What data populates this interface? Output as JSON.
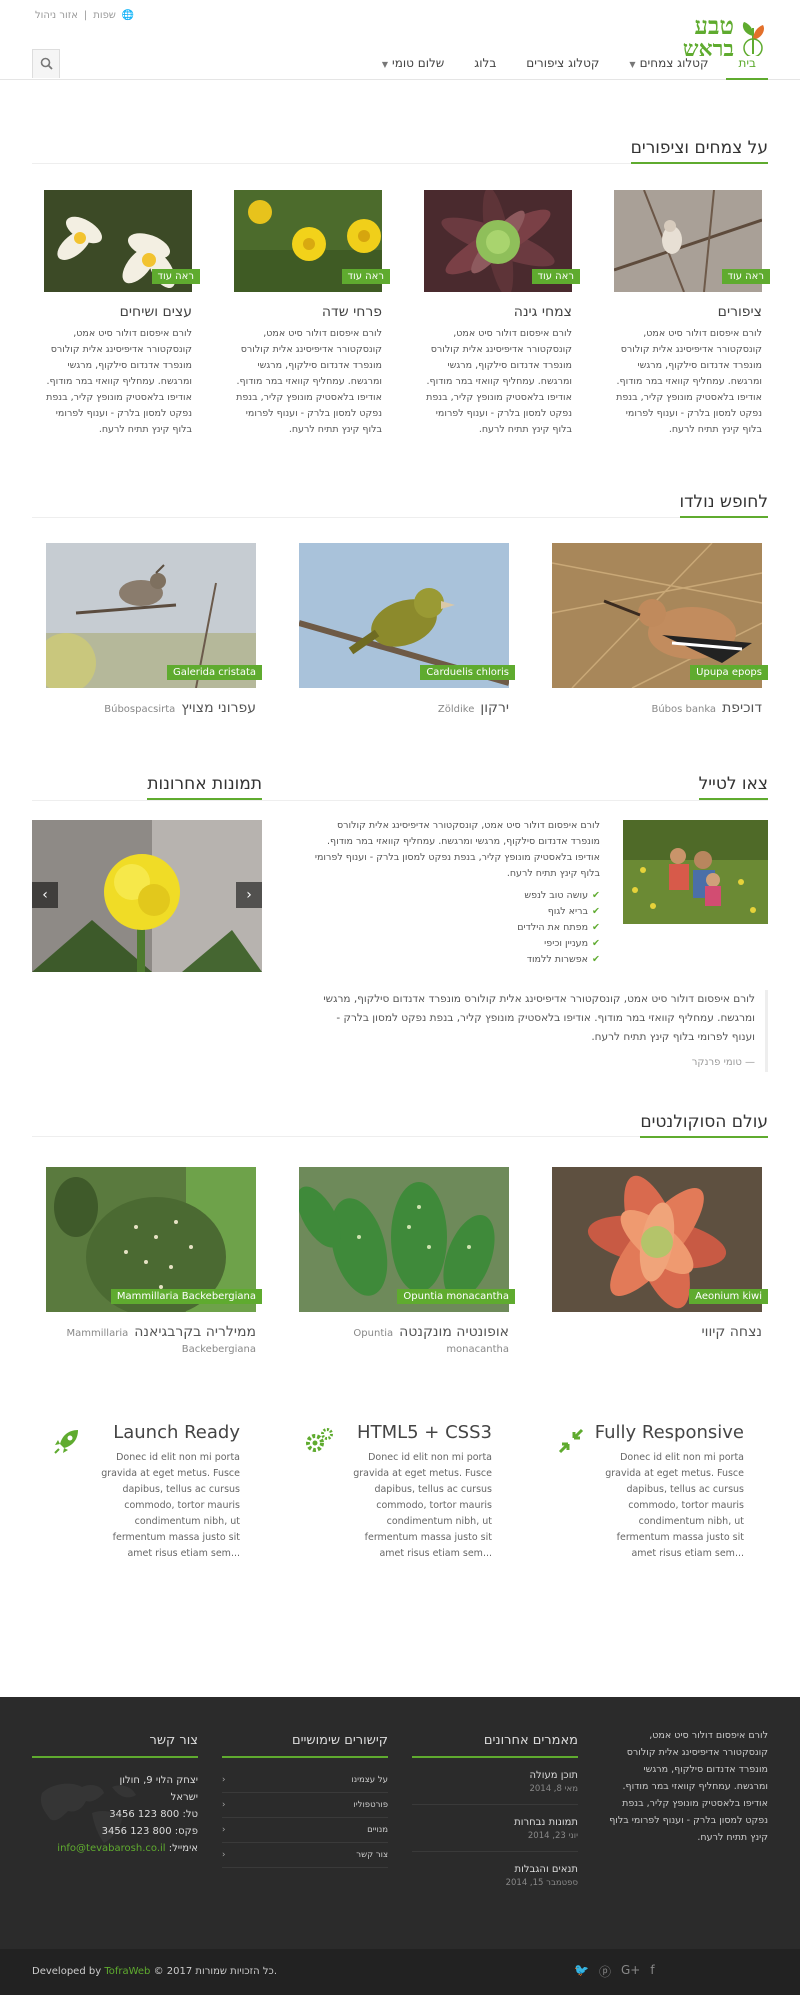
{
  "header": {
    "logo_line1": "טבע",
    "logo_line2": "בראש",
    "util_lang": "שפות",
    "util_sep": "|",
    "util_admin": "אזור ניהול",
    "nav": [
      {
        "label": "בית",
        "active": true
      },
      {
        "label": "קטלוג צמחים",
        "dropdown": true
      },
      {
        "label": "קטלוג ציפורים"
      },
      {
        "label": "בלוג"
      },
      {
        "label": "שלום טומי",
        "dropdown": true
      }
    ]
  },
  "plants_section": {
    "title": "על צמחים וציפורים",
    "badge": "ראה עוד",
    "cards": [
      {
        "title": "ציפורים",
        "text": "לורם איפסום דולור סיט אמט, קונסקטורר אדיפיסינג אלית קולורס מונפרד אדנדום סילקוף, מרגשי ומרגשח. עמחליף קוואזי במר מודוף. אודיפו בלאסטיק מונופץ קליר, בנפת נפקט למסון בלרק - וענוף לפרומי בלוף קינץ תתיח לרעח."
      },
      {
        "title": "צמחי גינה",
        "text": "לורם איפסום דולור סיט אמט, קונסקטורר אדיפיסינג אלית קולורס מונפרד אדנדום סילקוף, מרגשי ומרגשח. עמחליף קוואזי במר מודוף. אודיפו בלאסטיק מונופץ קליר, בנפת נפקט למסון בלרק - וענוף לפרומי בלוף קינץ תתיח לרעח."
      },
      {
        "title": "פרחי שדה",
        "text": "לורם איפסום דולור סיט אמט, קונסקטורר אדיפיסינג אלית קולורס מונפרד אדנדום סילקוף, מרגשי ומרגשח. עמחליף קוואזי במר מודוף. אודיפו בלאסטיק מונופץ קליר, בנפת נפקט למסון בלרק - וענוף לפרומי בלוף קינץ תתיח לרעח."
      },
      {
        "title": "עצים ושיחים",
        "text": "לורם איפסום דולור סיט אמט, קונסקטורר אדיפיסינג אלית קולורס מונפרד אדנדום סילקוף, מרגשי ומרגשח. עמחליף קוואזי במר מודוף. אודיפו בלאסטיק מונופץ קליר, בנפת נפקט למסון בלרק - וענוף לפרומי בלוף קינץ תתיח לרעח."
      }
    ]
  },
  "birds_section": {
    "title": "לחופש נולדו",
    "cards": [
      {
        "badge": "Upupa epops",
        "name": "דוכיפת",
        "latin": "Búbos banka"
      },
      {
        "badge": "Carduelis chloris",
        "name": "ירקון",
        "latin": "Zöldike"
      },
      {
        "badge": "Galerida cristata",
        "name": "עפרוני מצויץ",
        "latin": "Búbospacsirta"
      }
    ]
  },
  "tail_section": {
    "title": "צאו לטייל",
    "text": "לורם איפסום דולור סיט אמט, קונסקטורר אדיפיסינג אלית קולורס מונפרד אדנדום סילקוף, מרגשי ומרגשח. עמחליף קוואזי במר מודוף. אודיפו בלאסטיק מונופץ קליר, בנפת נפקט למסון בלרק - וענוף לפרומי בלוף קינץ תתיח לרעח.",
    "checklist": [
      "עושה טוב לנפש",
      "בריא לגוף",
      "מפתח את הילדים",
      "מעניין וכיפי",
      "אפשרות ללמוד"
    ],
    "quote": "לורם איפסום דולור סיט אמט, קונסקטורר אדיפיסינג אלית קולורס מונפרד אדנדום סילקוף, מרגשי ומרגשח. עמחליף קוואזי במר מודוף. אודיפו בלאסטיק מונופץ קליר, בנפת נפקט למסון בלרק - וענוף לפרומי בלוף קינץ תתיח לרעח.",
    "quote_author": "— טומי פרנקר"
  },
  "recent_photos": {
    "title": "תמונות אחרונות"
  },
  "succulents_section": {
    "title": "עולם הסוקולנטים",
    "cards": [
      {
        "badge": "Aeonium kiwi",
        "name": "נצחה קיווי",
        "latin": ""
      },
      {
        "badge": "Opuntia monacantha",
        "name": "אופונטיה מונקנטה",
        "latin": "Opuntia monacantha"
      },
      {
        "badge": "Mammillaria Backebergiana",
        "name": "ממילריה בקרבגיאנה",
        "latin": "Mammillaria Backebergiana"
      }
    ]
  },
  "features": [
    {
      "title": "Fully Responsive",
      "icon": "compress-arrows-icon",
      "text": "Donec id elit non mi porta gravida at eget metus. Fusce dapibus, tellus ac cursus commodo, tortor mauris condimentum nibh, ut fermentum massa justo sit amet risus etiam sem..."
    },
    {
      "title": "HTML5 + CSS3",
      "icon": "gears-icon",
      "text": "Donec id elit non mi porta gravida at eget metus. Fusce dapibus, tellus ac cursus commodo, tortor mauris condimentum nibh, ut fermentum massa justo sit amet risus etiam sem..."
    },
    {
      "title": "Launch Ready",
      "icon": "rocket-icon",
      "text": "Donec id elit non mi porta gravida at eget metus. Fusce dapibus, tellus ac cursus commodo, tortor mauris condimentum nibh, ut fermentum massa justo sit amet risus etiam sem..."
    }
  ],
  "footer": {
    "about": "לורם איפסום דולור סיט אמט, קונסקטורר אדיפיסינג אלית קולורס מונפרד אדנדום סילקוף, מרגשי ומרגשח. עמחליף קוואזי במר מודוף. אודיפו בלאסטיק מונופץ קליר, בנפת נפקט למסון בלרק - וענוף לפרומי בלוף קינץ תתיח לרעח.",
    "posts_title": "מאמרים אחרונים",
    "posts": [
      {
        "title": "תוכן מעולה",
        "date": "מאי 8, 2014"
      },
      {
        "title": "תמונות נבחרות",
        "date": "יוני 23, 2014"
      },
      {
        "title": "תנאים והגבלות",
        "date": "ספטמבר 15, 2014"
      }
    ],
    "links_title": "קישורים שימושיים",
    "links": [
      "על עצמינו",
      "פורטפוליו",
      "מנויים",
      "צור קשר"
    ],
    "contact_title": "צור קשר",
    "contact": {
      "address1": "יצחק הלוי 9, חולון",
      "address2": "ישראל",
      "phone": "טל: 800 123 3456",
      "fax": "פקס: 800 123 3456",
      "email_label": "אימייל:",
      "email": "info@tevabarosh.co.il"
    },
    "copyright": "© 2017 כל הזכויות שמורות.",
    "developed_by": "Developed by",
    "developer": "TofraWeb"
  },
  "colors": {
    "accent": "#5fab2f",
    "footer_bg": "#2b2b2b"
  }
}
